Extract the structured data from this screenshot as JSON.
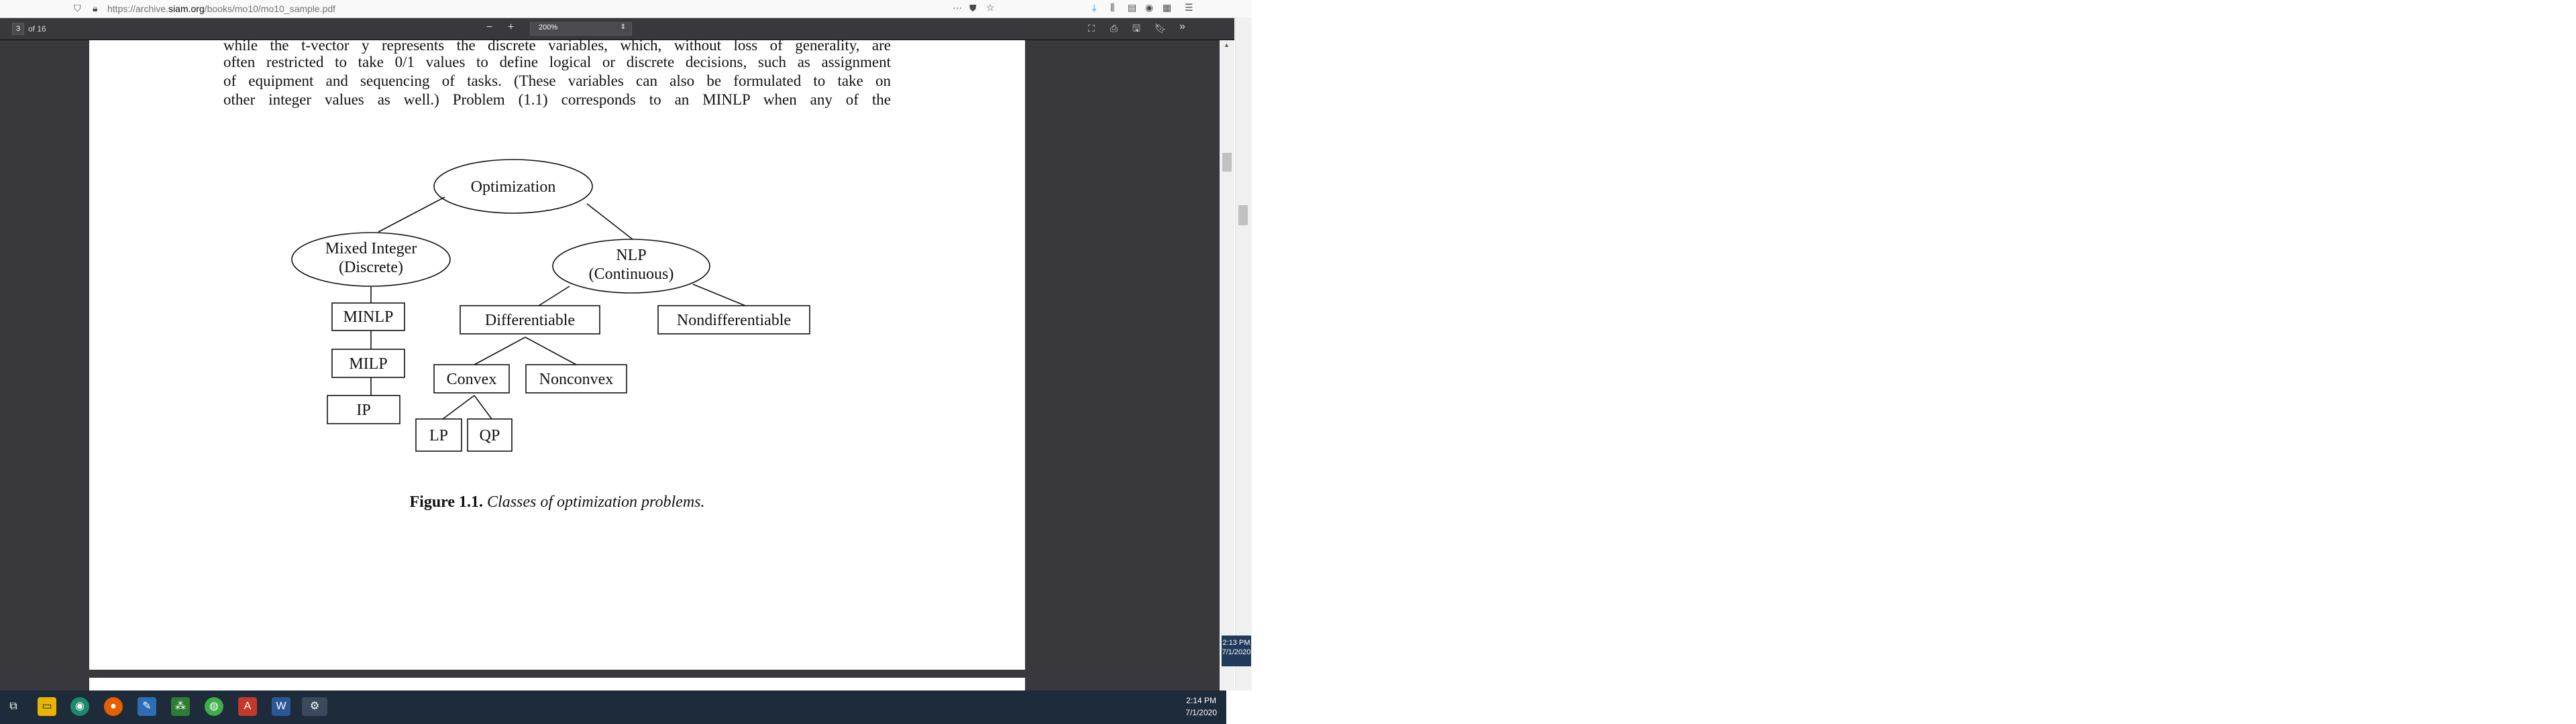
{
  "browser": {
    "url_prefix": "https://archive.",
    "url_domain": "siam.org",
    "url_path": "/books/mo10/mo10_sample.pdf"
  },
  "pdf_toolbar": {
    "page_number": "3",
    "page_count": "of 16",
    "zoom": "200%"
  },
  "document": {
    "lines": [
      "while the t-vector y represents the discrete variables, which, without loss of generality, are",
      "often restricted to take 0/1 values to define logical or discrete decisions, such as assignment",
      "of equipment and sequencing of tasks. (These variables can also be formulated to take on",
      "other integer values as well.) Problem (1.1) corresponds to an MINLP when any of the"
    ],
    "diagram": {
      "root": "Optimization",
      "mixed_integer_1": "Mixed Integer",
      "mixed_integer_2": "(Discrete)",
      "nlp_1": "NLP",
      "nlp_2": "(Continuous)",
      "minlp": "MINLP",
      "milp": "MILP",
      "ip": "IP",
      "differentiable": "Differentiable",
      "nondifferentiable": "Nondifferentiable",
      "convex": "Convex",
      "nonconvex": "Nonconvex",
      "lp": "LP",
      "qp": "QP"
    },
    "caption_label": "Figure 1.1.",
    "caption_text": "Classes of optimization problems."
  },
  "side_clock": {
    "time": "2:13 PM",
    "date": "7/1/2020"
  },
  "taskbar": {
    "time": "2:14 PM",
    "date": "7/1/2020"
  }
}
